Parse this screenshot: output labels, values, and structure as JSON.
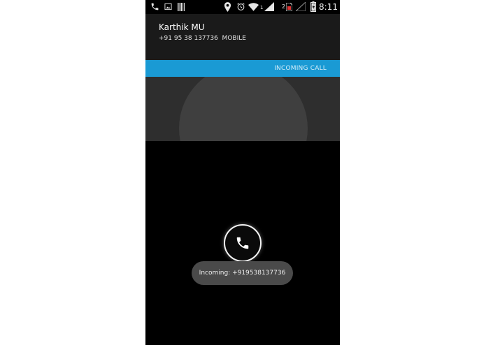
{
  "status_bar": {
    "time": "8:11",
    "sim1_label": "1",
    "sim2_label": "2",
    "icons": [
      "phone-icon",
      "image-icon",
      "barcode-icon",
      "location-icon",
      "alarm-icon",
      "wifi-icon",
      "signal-icon",
      "sim-card-icon",
      "no-signal-icon",
      "battery-icon"
    ]
  },
  "caller": {
    "name": "Karthik MU",
    "number": "+91 95 38 137736  MOBILE"
  },
  "call_state": {
    "label": "INCOMING CALL",
    "accent_color": "#1a9ad4"
  },
  "actions": {
    "answer_icon": "phone-icon"
  },
  "toast": {
    "text": "Incoming: +919538137736"
  }
}
